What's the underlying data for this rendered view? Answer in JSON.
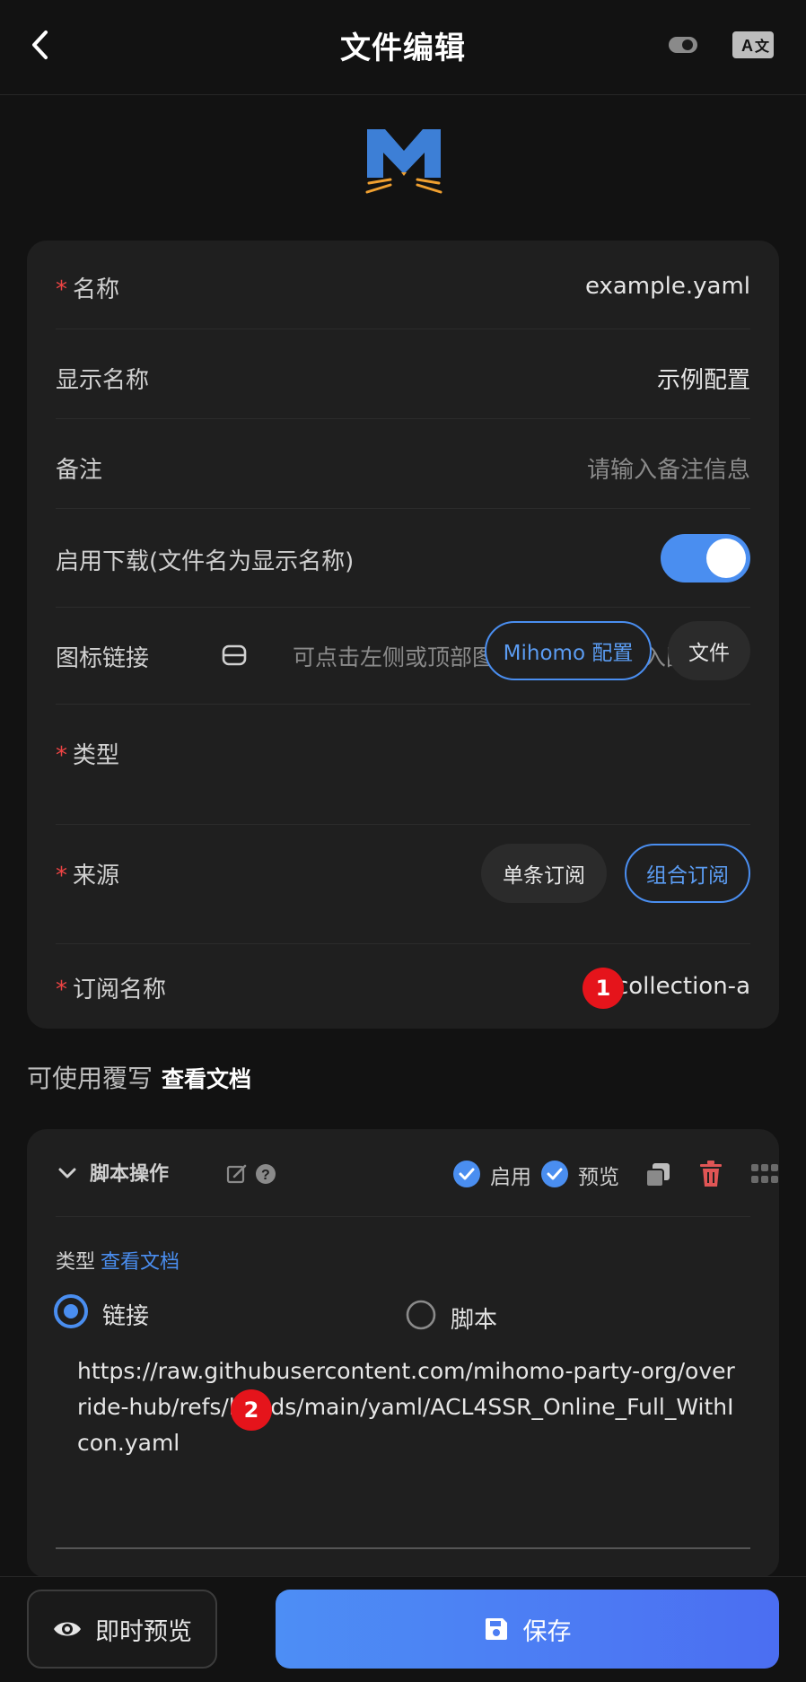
{
  "header": {
    "title": "文件编辑",
    "back_icon": "chevron-left-icon",
    "theme_icon": "toggle-icon",
    "translate_icon": "translate-icon"
  },
  "form": {
    "name": {
      "label": "名称",
      "value": "example.yaml"
    },
    "display_name": {
      "label": "显示名称",
      "value": "示例配置"
    },
    "remark": {
      "label": "备注",
      "placeholder": "请输入备注信息"
    },
    "download": {
      "label": "启用下载(文件名为显示名称)",
      "enabled": true
    },
    "icon_link": {
      "label": "图标链接",
      "placeholder": "可点击左侧或顶部图标, 从图标库填入图标"
    },
    "type": {
      "label": "类型",
      "options": [
        "Mihomo 配置",
        "文件"
      ],
      "selected": "Mihomo 配置"
    },
    "source": {
      "label": "来源",
      "options": [
        "单条订阅",
        "组合订阅"
      ],
      "selected": "组合订阅"
    },
    "sub_name": {
      "label": "订阅名称",
      "value": "collection-a"
    }
  },
  "badges": [
    "1",
    "2"
  ],
  "override_section": {
    "title": "可使用覆写",
    "doc_link": "查看文档"
  },
  "override": {
    "title": "脚本操作",
    "enable_label": "启用",
    "preview_label": "预览",
    "type_label": "类型",
    "type_doc_link": "查看文档",
    "modes": [
      "链接",
      "脚本"
    ],
    "selected_mode": "链接",
    "url": "https://raw.githubusercontent.com/mihomo-party-org/override-hub/refs/heads/main/yaml/ACL4SSR_Online_Full_WithIcon.yaml"
  },
  "bottom": {
    "preview_label": "即时预览",
    "save_label": "保存"
  },
  "colors": {
    "accent": "#4a8ef0",
    "required": "#ef4444",
    "badge": "#e5141b",
    "delete": "#e05555"
  }
}
